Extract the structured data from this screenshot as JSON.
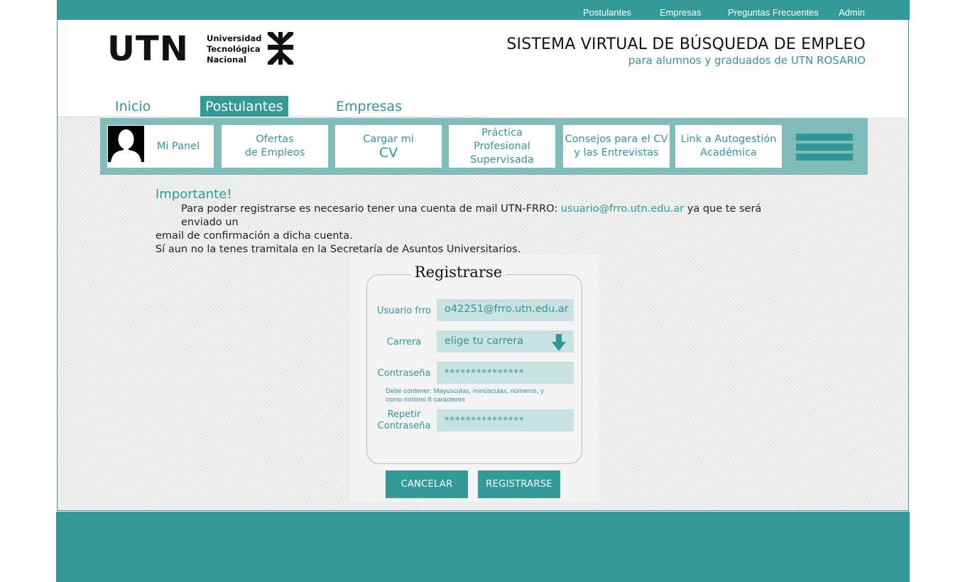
{
  "topnav": {
    "items": [
      "Postulantes",
      "Empresas",
      "Preguntas Frecuentes",
      "Admin"
    ]
  },
  "logo": {
    "acronym": "UTN",
    "line1": "Universidad",
    "line2": "Tecnológica",
    "line3": "Nacional"
  },
  "site": {
    "title": "SISTEMA VIRTUAL DE BÚSQUEDA DE EMPLEO",
    "subtitle": "para alumnos y graduados de UTN ROSARIO"
  },
  "maintabs": [
    {
      "label": "Inicio"
    },
    {
      "label": "Postulantes"
    },
    {
      "label": "Empresas"
    }
  ],
  "subnav": {
    "panel": "Mi Panel",
    "ofertas_1": "Ofertas",
    "ofertas_2": "de Empleos",
    "cargar_1": "Cargar mi",
    "cargar_2": "CV",
    "practica_1": "Práctica",
    "practica_2": "Profesional",
    "practica_3": "Supervisada",
    "consejos_1": "Consejos para el CV",
    "consejos_2": "y las Entrevistas",
    "link_1": "Link a Autogestión",
    "link_2": "Académica"
  },
  "notice": {
    "heading": "Importante!",
    "text_1": "Para poder registrarse es necesario tener una cuenta de mail UTN-FRRO:",
    "email": "usuario@frro.utn.edu.ar",
    "text_2": "ya que te será enviado un",
    "text_3": "email de confirmación a dicha cuenta.",
    "text_4": "Sí aun no la tenes tramitala en la Secretaría de Asuntos Universitarios."
  },
  "form": {
    "title": "Registrarse",
    "user_label": "Usuario frro",
    "user_value": "o42251@frro.utn.edu.ar",
    "career_label": "Carrera",
    "career_value": "elige tu carrera",
    "password_label": "Contraseña",
    "password_value": "***************",
    "hint_1": "Debe contener: Mayusculas, minúsculas, números, y",
    "hint_2": "como mínimo 8 caracteres",
    "repeat_label_1": "Repetir",
    "repeat_label_2": "Contraseña",
    "repeat_value": "***************",
    "cancel": "CANCELAR",
    "submit": "REGISTRARSE"
  },
  "colors": {
    "primary": "#349a98",
    "primary_light": "#7fbcba",
    "input_bg": "#c8e1e1"
  }
}
